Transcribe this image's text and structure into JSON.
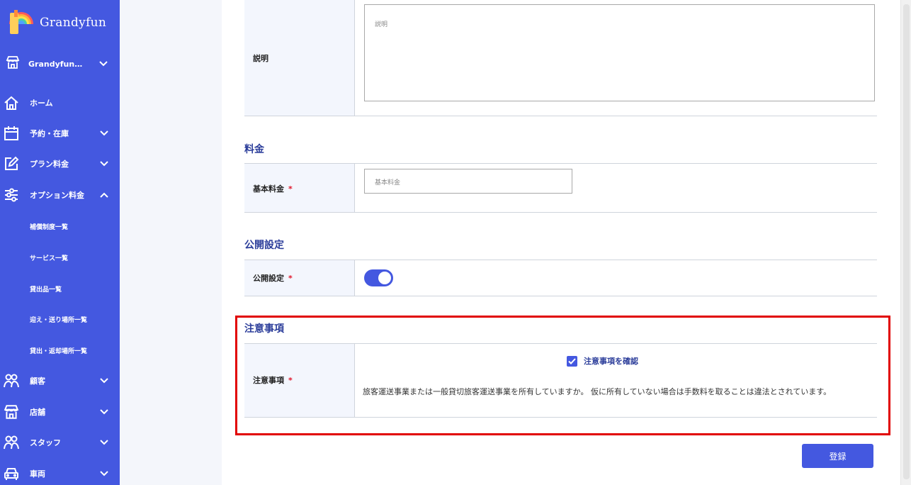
{
  "brand": {
    "name": "Grandyfun"
  },
  "colors": {
    "sidebar": "#4458e0",
    "accent": "#4458e0",
    "highlight": "#e10000",
    "required": "#e0162b"
  },
  "sidebar": {
    "store_select": {
      "label": "Grandyfun…",
      "icon": "store-icon"
    },
    "items": [
      {
        "label": "ホーム",
        "icon": "home-icon"
      },
      {
        "label": "予約・在庫",
        "icon": "calendar-icon"
      },
      {
        "label": "プラン料金",
        "icon": "edit-icon"
      },
      {
        "label": "オプション料金",
        "icon": "sliders-icon"
      },
      {
        "label": "顧客",
        "icon": "users-icon"
      },
      {
        "label": "店舗",
        "icon": "store-icon"
      },
      {
        "label": "スタッフ",
        "icon": "users-icon"
      },
      {
        "label": "車両",
        "icon": "car-icon"
      }
    ],
    "sub_items": [
      "補償制度一覧",
      "サービス一覧",
      "貸出品一覧",
      "迎え・送り場所一覧",
      "貸出・返却場所一覧"
    ]
  },
  "form": {
    "description": {
      "label": "説明",
      "placeholder": "説明"
    },
    "price_section": {
      "title": "料金"
    },
    "base_price": {
      "label": "基本料金",
      "required_mark": "*",
      "placeholder": "基本料金"
    },
    "publish_section": {
      "title": "公開設定"
    },
    "publish": {
      "label": "公開設定",
      "required_mark": "*",
      "value": true
    },
    "notes_section": {
      "title": "注意事項"
    },
    "notes": {
      "label": "注意事項",
      "required_mark": "*",
      "checkbox_label": "注意事項を確認",
      "checked": true,
      "text": "旅客運送事業または一般貸切旅客運送事業を所有していますか。 仮に所有していない場合は手数料を取ることは違法とされています。"
    },
    "submit_label": "登録"
  }
}
